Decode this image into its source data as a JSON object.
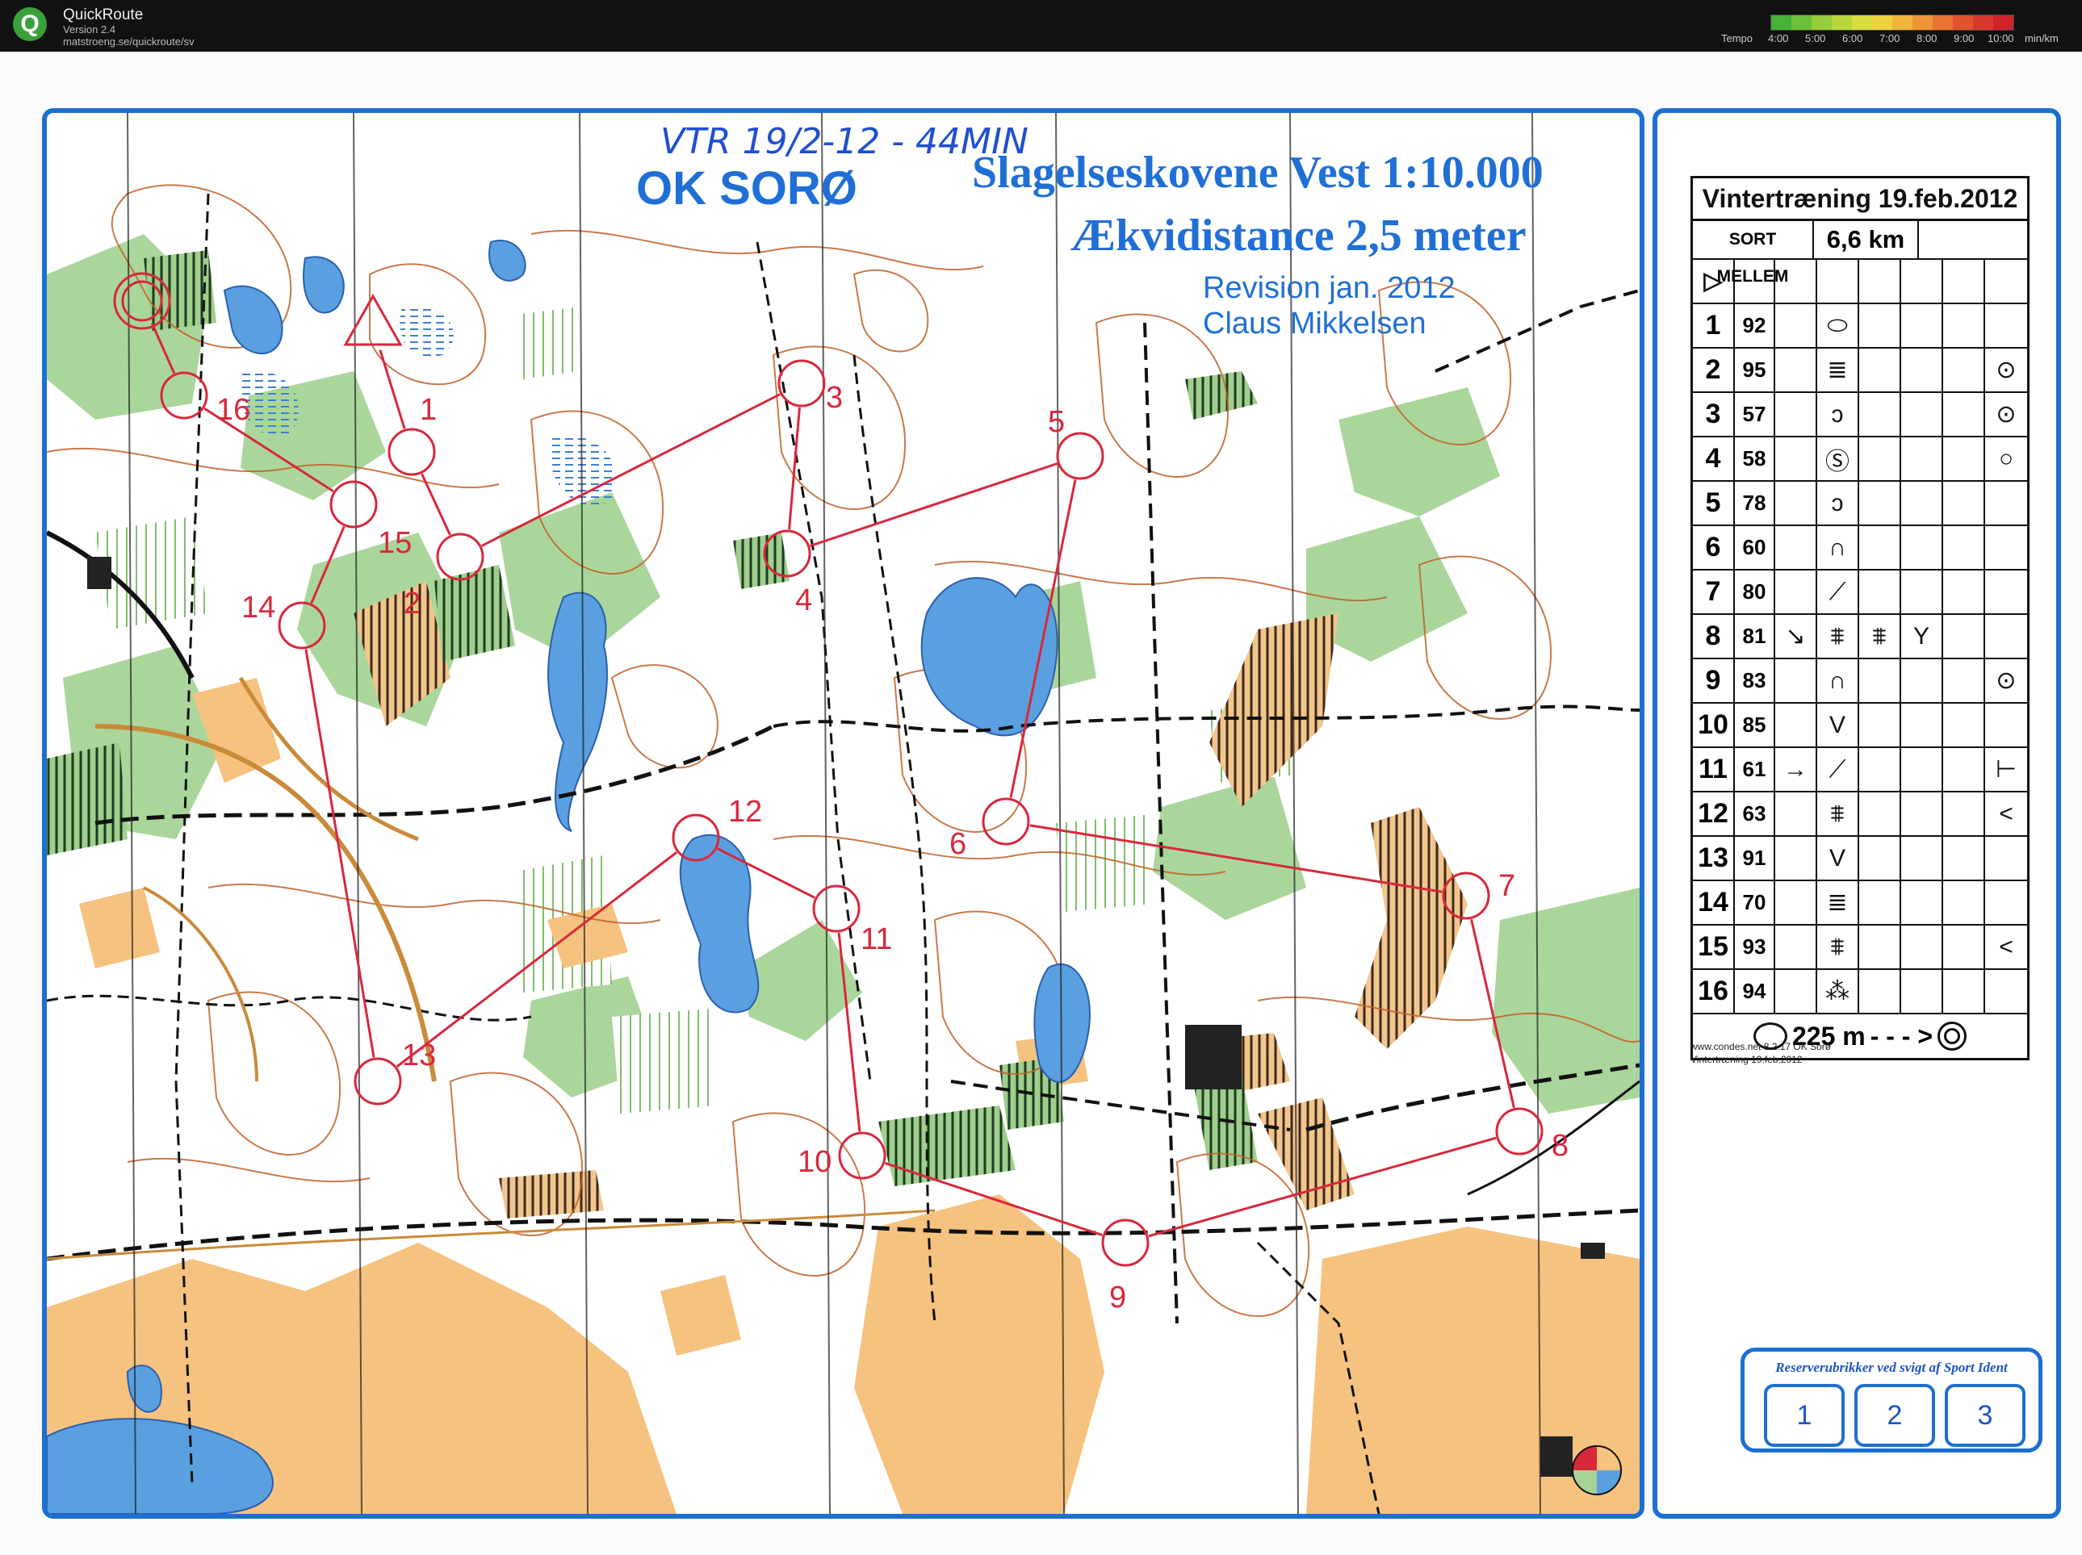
{
  "app": {
    "logo_letter": "Q",
    "title": "QuickRoute",
    "version": "Version 2.4",
    "url": "matstroeng.se/quickroute/sv",
    "tempo_label": "Tempo",
    "tempo_ticks": [
      "4:00",
      "5:00",
      "6:00",
      "7:00",
      "8:00",
      "9:00",
      "10:00",
      "min/km"
    ],
    "tempo_colors": [
      "#46b03a",
      "#6cbf3b",
      "#94cc3c",
      "#b9d63d",
      "#d8dc3f",
      "#ecd23f",
      "#f0b53b",
      "#ee9637",
      "#e97434",
      "#e25431",
      "#d9382e",
      "#cf232b"
    ]
  },
  "map": {
    "hand_note": "VTR 19/2-12 - 44MIN",
    "club": "OK SORØ",
    "name": "Slagelseskovene Vest 1:10.000",
    "contour": "Ækvidistance 2,5 meter",
    "revision": "Revision jan. 2012",
    "author": "Claus Mikkelsen",
    "controls": [
      {
        "label": "1"
      },
      {
        "label": "2"
      },
      {
        "label": "3"
      },
      {
        "label": "4"
      },
      {
        "label": "5"
      },
      {
        "label": "6"
      },
      {
        "label": "7"
      },
      {
        "label": "8"
      },
      {
        "label": "9"
      },
      {
        "label": "10"
      },
      {
        "label": "11"
      },
      {
        "label": "12"
      },
      {
        "label": "13"
      },
      {
        "label": "14"
      },
      {
        "label": "15"
      },
      {
        "label": "16"
      }
    ]
  },
  "description": {
    "title": "Vintertræning 19.feb.2012",
    "class_name": "SORT MELLEM",
    "length": "6,6 km",
    "start_symbol": "▷",
    "rows": [
      {
        "num": "1",
        "code": "92",
        "c": "",
        "d": "⬭",
        "e": "",
        "f": "",
        "g": ""
      },
      {
        "num": "2",
        "code": "95",
        "c": "",
        "d": "≣",
        "e": "",
        "f": "",
        "g": "⊙"
      },
      {
        "num": "3",
        "code": "57",
        "c": "",
        "d": "ↄ",
        "e": "",
        "f": "",
        "g": "⊙"
      },
      {
        "num": "4",
        "code": "58",
        "c": "",
        "d": "Ⓢ",
        "e": "",
        "f": "",
        "g": "○"
      },
      {
        "num": "5",
        "code": "78",
        "c": "",
        "d": "ↄ",
        "e": "",
        "f": "",
        "g": ""
      },
      {
        "num": "6",
        "code": "60",
        "c": "",
        "d": "∩",
        "e": "",
        "f": "",
        "g": ""
      },
      {
        "num": "7",
        "code": "80",
        "c": "",
        "d": "⟋",
        "e": "",
        "f": "",
        "g": ""
      },
      {
        "num": "8",
        "code": "81",
        "c": "↘",
        "d": "⩨",
        "e": "⩨",
        "f": "Y",
        "g": ""
      },
      {
        "num": "9",
        "code": "83",
        "c": "",
        "d": "∩",
        "e": "",
        "f": "",
        "g": "⊙"
      },
      {
        "num": "10",
        "code": "85",
        "c": "",
        "d": "V",
        "e": "",
        "f": "",
        "g": ""
      },
      {
        "num": "11",
        "code": "61",
        "c": "→",
        "d": "⟋",
        "e": "",
        "f": "",
        "g": "⊢"
      },
      {
        "num": "12",
        "code": "63",
        "c": "",
        "d": "⩨",
        "e": "",
        "f": "",
        "g": "<"
      },
      {
        "num": "13",
        "code": "91",
        "c": "",
        "d": "V",
        "e": "",
        "f": "",
        "g": ""
      },
      {
        "num": "14",
        "code": "70",
        "c": "",
        "d": "≣",
        "e": "",
        "f": "",
        "g": ""
      },
      {
        "num": "15",
        "code": "93",
        "c": "",
        "d": "⩨",
        "e": "",
        "f": "",
        "g": "<"
      },
      {
        "num": "16",
        "code": "94",
        "c": "",
        "d": "⁂",
        "e": "",
        "f": "",
        "g": ""
      }
    ],
    "finish_distance": "225 m",
    "finish_arrow": "- - - >",
    "note1": "www.condes.net 8.2.17 OK Sorø",
    "note2": "Vintertræning 19.feb.2012"
  },
  "reserve": {
    "title": "Reserverubrikker ved svigt af Sport Ident",
    "boxes": [
      "1",
      "2",
      "3"
    ]
  },
  "colors": {
    "frame": "#1d6fd0",
    "course": "#d8283c",
    "forest_green": "#8cc47a",
    "open_yellow": "#f2b769",
    "water": "#5aa0e0",
    "contour": "#c0622a"
  }
}
